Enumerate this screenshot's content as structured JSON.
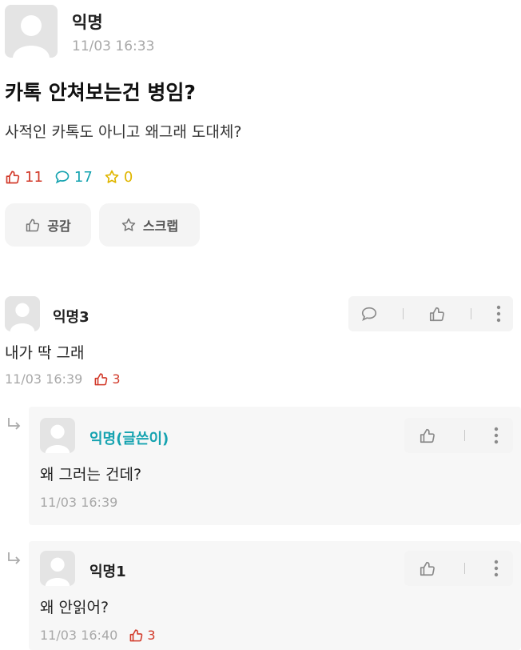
{
  "post": {
    "author": "익명",
    "time": "11/03 16:33",
    "title": "카톡 안쳐보는건 병임?",
    "body": "사적인 카톡도 아니고 왜그래 도대체?",
    "stats": {
      "likes": "11",
      "comments": "17",
      "scraps": "0"
    },
    "buttons": {
      "like": "공감",
      "scrap": "스크랩"
    }
  },
  "comments": [
    {
      "author": "익명3",
      "text": "내가 딱 그래",
      "time": "11/03 16:39",
      "likes": "3"
    },
    {
      "author": "익명(글쓴이)",
      "text": "왜 그러는 건데?",
      "time": "11/03 16:39",
      "likes": ""
    },
    {
      "author": "익명1",
      "text": "왜 안읽어?",
      "time": "11/03 16:40",
      "likes": "3"
    }
  ],
  "colors": {
    "like_red": "#d23a2a",
    "author_teal": "#16a3b0",
    "scrap_amber": "#e0b600"
  }
}
